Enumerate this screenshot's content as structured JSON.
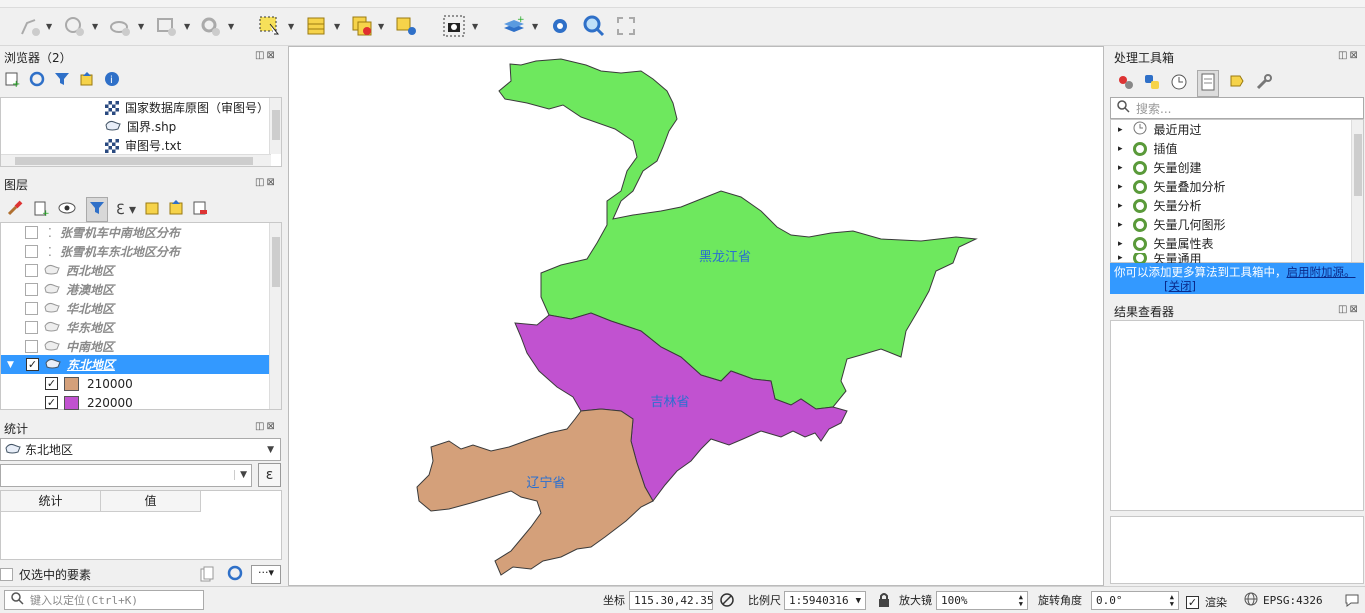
{
  "browser": {
    "title": "浏览器（2）",
    "items": [
      "国家数据库原图（审图号）",
      "国界.shp",
      "审图号.txt"
    ]
  },
  "layers": {
    "title": "图层",
    "items": [
      {
        "label": "张雪机车中南地区分布",
        "checked": false
      },
      {
        "label": "张雪机车东北地区分布",
        "checked": false
      },
      {
        "label": "西北地区",
        "checked": false
      },
      {
        "label": "港澳地区",
        "checked": false
      },
      {
        "label": "华北地区",
        "checked": false
      },
      {
        "label": "华东地区",
        "checked": false
      },
      {
        "label": "中南地区",
        "checked": false
      },
      {
        "label": "东北地区",
        "checked": true,
        "selected": true
      }
    ],
    "legend": [
      {
        "label": "210000",
        "color": "#d4a07a",
        "checked": true
      },
      {
        "label": "220000",
        "color": "#c152d0",
        "checked": true
      }
    ]
  },
  "stats": {
    "title": "统计",
    "layer_select": "东北地区",
    "field_value": "",
    "expr_btn": "ε",
    "col_stat": "统计",
    "col_value": "值",
    "selected_only": "仅选中的要素"
  },
  "map": {
    "labels": {
      "heilongjiang": "黑龙江省",
      "jilin": "吉林省",
      "liaoning": "辽宁省"
    },
    "colors": {
      "heilongjiang": "#6ee85e",
      "jilin": "#c152d0",
      "liaoning": "#d4a07a"
    }
  },
  "processing": {
    "title": "处理工具箱",
    "search_placeholder": "搜索...",
    "items": [
      "最近用过",
      "插值",
      "矢量创建",
      "矢量叠加分析",
      "矢量分析",
      "矢量几何图形",
      "矢量属性表",
      "矢量通用"
    ],
    "banner_text": "你可以添加更多算法到工具箱中，",
    "banner_link": "启用附加源。",
    "banner_close": "[关闭]"
  },
  "results": {
    "title": "结果查看器"
  },
  "statusbar": {
    "locate_placeholder": "键入以定位(Ctrl+K)",
    "coord_label": "坐标",
    "coord_value": "115.30,42.35",
    "scale_label": "比例尺",
    "scale_value": "1:5940316",
    "magnifier_label": "放大镜",
    "magnifier_value": "100%",
    "rotation_label": "旋转角度",
    "rotation_value": "0.0°",
    "render_label": "渲染",
    "crs": "EPSG:4326"
  }
}
